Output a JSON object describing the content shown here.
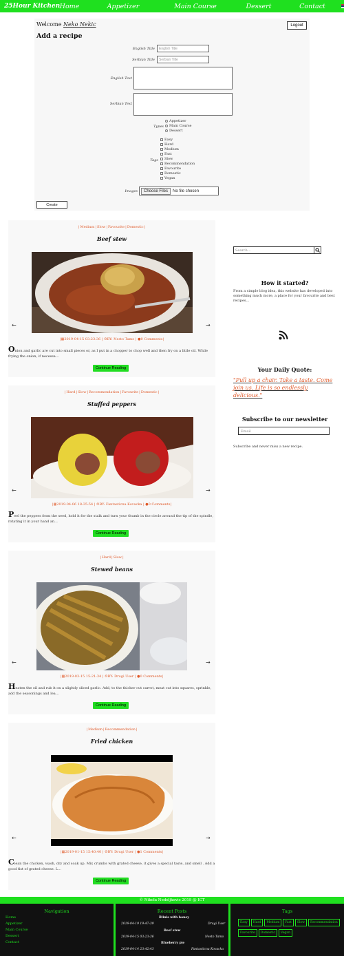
{
  "nav": {
    "brand": "25Hour Kitchen",
    "items": [
      "Home",
      "Appetizer",
      "Main Course",
      "Dessert",
      "Contact"
    ],
    "flags": [
      "serbian-flag-icon",
      "english-flag-icon"
    ]
  },
  "add_form": {
    "welcome": "Welcome",
    "user": "Neko Nekic",
    "logout": "Logout",
    "title": "Add a recipe",
    "english_title_label": "English Title",
    "english_title_placeholder": "English Title",
    "serbian_title_label": "Serbian Title",
    "serbian_title_placeholder": "Serbian Title",
    "english_text_label": "English Text",
    "serbian_text_label": "Serbian Text",
    "types_label": "Types",
    "types": [
      "Appetizer",
      "Main Course",
      "Dessert"
    ],
    "tags_label": "Tags",
    "tags": [
      "Easy",
      "Hard",
      "Medium",
      "Fast",
      "Slow",
      "Recommendation",
      "Favourite",
      "Domestic",
      "Vegan"
    ],
    "images_label": "Images",
    "choose_files": "Choose Files",
    "no_file": "No file chosen",
    "create": "Create"
  },
  "posts": [
    {
      "tags": [
        "Medium",
        "Slow",
        "Favourite",
        "Domestic"
      ],
      "title": "Beef stew",
      "date": "2019-04-15 03:23:36",
      "author": "BY: Nesto Tamo",
      "comments": "0 Comments",
      "excerpt_first": "O",
      "excerpt": "nion and garlic are cut into small pieces or, as I put in a chopper to chop well and then fry on a little oil. While frying the onion, if necessa...",
      "button": "Continue Reading"
    },
    {
      "tags": [
        "Hard",
        "Slow",
        "Recommendation",
        "Favourite",
        "Domestic"
      ],
      "title": "Stuffed peppers",
      "date": "2019-04-06 18:35:54",
      "author": "BY: Fantasticna Kovacka",
      "comments": "0 Comments",
      "excerpt_first": "P",
      "excerpt": "eel the peppers from the seed, hold it for the stalk and turn your thumb in the circle around the tip of the spindle, rotating it in your hand an...",
      "button": "Continue Reading"
    },
    {
      "tags": [
        "Hard",
        "Slow"
      ],
      "title": "Stewed beans",
      "date": "2019-03-15 15:21:34",
      "author": "BY: Drugi User",
      "comments": "0 Comments",
      "excerpt_first": "H",
      "excerpt": "eaten the oil and rub it on a slightly sliced garlic. Add, to the thicker cut carrot, meat cut into squares, sprinkle, add the seasonings and lea...",
      "button": "Continue Reading"
    },
    {
      "tags": [
        "Medium",
        "Recommendation"
      ],
      "title": "Fried chicken",
      "date": "2019-01-15 15:40:40",
      "author": "BY: Drugi User",
      "comments": "1 Comments",
      "excerpt_first": "C",
      "excerpt": "lean the chicken, wash, dry and soak up. Mix crumbs with grated cheese, it gives a special taste, and smell . Add a good fist of grated cheese. L...",
      "button": "Continue Reading"
    }
  ],
  "sidebar": {
    "search_placeholder": "Search...",
    "how_title": "How it started?",
    "how_text": "From a simple blog idea, this website has developed into something much more, a place for your favourite and best recipes...",
    "quote_title": "Your Daily Quote:",
    "quote": "\"Pull up a chair. Take a taste. Come join us. Life is so endlessly delicious.\"",
    "newsletter_title": "Subscribe to our newsletter",
    "email_placeholder": "Email",
    "newsletter_text": "Subscribe and never miss a new recipe."
  },
  "footer": {
    "copyright": "© Nikola Nedeljkovic 2019    @ ICT",
    "nav_title": "Navigation",
    "nav_items": [
      "Home",
      "Appetizer",
      "Main Course",
      "Dessert",
      "Contact"
    ],
    "recent_title": "Recent Posts",
    "recent": [
      {
        "title": "Blinis with honey",
        "date": "2019-04-19 19:47:39",
        "author": "Drugi User"
      },
      {
        "title": "Beef stew",
        "date": "2019-04-15 03:23:36",
        "author": "Nesto Tamo"
      },
      {
        "title": "Blueberry pie",
        "date": "2019-04-14 23:42:43",
        "author": "Fantasticna Kovacka"
      }
    ],
    "tags_title": "Tags",
    "tags": [
      "Easy",
      "Hard",
      "Medium",
      "Fast",
      "Slow",
      "Recommendation",
      "Favourite",
      "Domestic",
      "Vegan"
    ]
  },
  "colors": {
    "accent": "#1fe01f",
    "link": "#e05a2a",
    "button": "#22dd22",
    "footer_bg": "#111111"
  }
}
